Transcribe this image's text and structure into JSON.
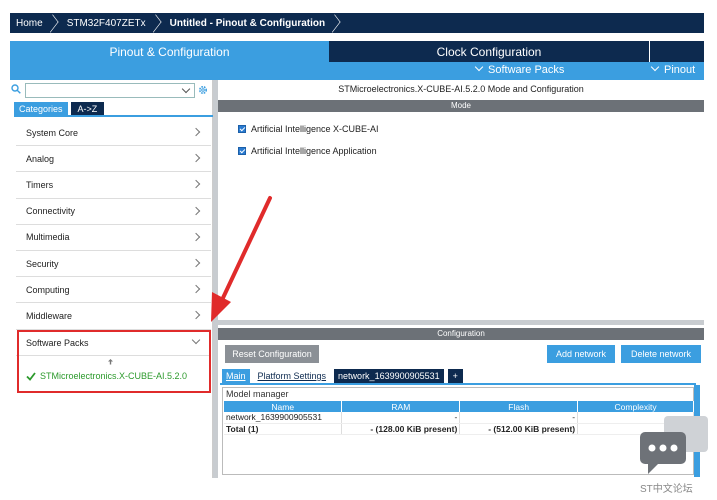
{
  "breadcrumb": [
    "Home",
    "STM32F407ZETx",
    "Untitled - Pinout & Configuration"
  ],
  "tabs": {
    "pinout": "Pinout & Configuration",
    "clock": "Clock Configuration"
  },
  "subbar": {
    "software_packs": "Software Packs",
    "pinout": "Pinout"
  },
  "left": {
    "category_tabs": [
      "Categories",
      "A->Z"
    ],
    "categories": [
      "System Core",
      "Analog",
      "Timers",
      "Connectivity",
      "Multimedia",
      "Security",
      "Computing",
      "Middleware"
    ],
    "software_packs_label": "Software Packs",
    "software_pack_item": "STMicroelectronics.X-CUBE-AI.5.2.0"
  },
  "right": {
    "title": "STMicroelectronics.X-CUBE-AI.5.2.0 Mode and Configuration",
    "mode_label": "Mode",
    "mode_options": [
      "Artificial Intelligence X-CUBE-AI",
      "Artificial Intelligence Application"
    ],
    "config_label": "Configuration",
    "reset_button": "Reset Configuration",
    "add_network_button": "Add network",
    "delete_network_button": "Delete network",
    "config_tabs": [
      "Main",
      "Platform Settings",
      "network_1639900905531",
      "+"
    ],
    "model_manager_label": "Model manager",
    "table": {
      "headers": [
        "Name",
        "RAM",
        "Flash",
        "Complexity"
      ],
      "rows": [
        [
          "network_1639900905531",
          "-",
          "-",
          "-"
        ],
        [
          "Total (1)",
          "- (128.00 KiB present)",
          "- (512.00 KiB present)",
          "-"
        ]
      ]
    }
  },
  "watermark": "ST中文论坛",
  "colors": {
    "navy": "#0d2a4f",
    "accent": "#3b9ee0",
    "annotation": "#e02b2b"
  }
}
